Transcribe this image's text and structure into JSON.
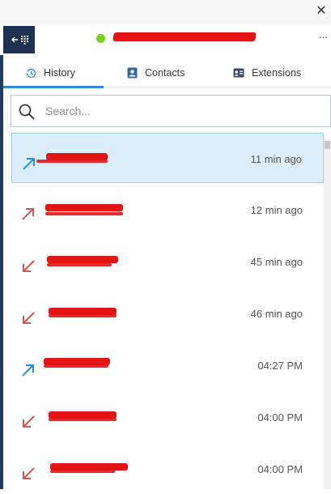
{
  "window": {
    "close_icon": "close-icon",
    "more_icon": "more-options-icon"
  },
  "header": {
    "back_icon": "back-arrow-icon",
    "dialpad_icon": "dialpad-icon",
    "presence_color": "#7bd21c",
    "redaction_color": "#e31414"
  },
  "tabs": [
    {
      "label": "History",
      "icon": "history-icon",
      "active": true
    },
    {
      "label": "Contacts",
      "icon": "contacts-icon",
      "active": false
    },
    {
      "label": "Extensions",
      "icon": "extensions-icon",
      "active": false
    }
  ],
  "search": {
    "placeholder": "Search...",
    "value": ""
  },
  "colors": {
    "accent": "#2b8fd8",
    "outgoing_call": "#2b8fd8",
    "missed_call": "#c85a5a",
    "selected_row": "#dceefb"
  },
  "history": [
    {
      "direction": "outgoing",
      "time": "11 min ago",
      "selected": true
    },
    {
      "direction": "missed-outgoing",
      "time": "12 min ago",
      "selected": false
    },
    {
      "direction": "missed-incoming",
      "time": "45 min ago",
      "selected": false
    },
    {
      "direction": "missed-incoming",
      "time": "46 min ago",
      "selected": false
    },
    {
      "direction": "outgoing",
      "time": "04:27 PM",
      "selected": false
    },
    {
      "direction": "missed-incoming",
      "time": "04:00 PM",
      "selected": false
    },
    {
      "direction": "missed-incoming",
      "time": "04:00 PM",
      "selected": false
    }
  ]
}
